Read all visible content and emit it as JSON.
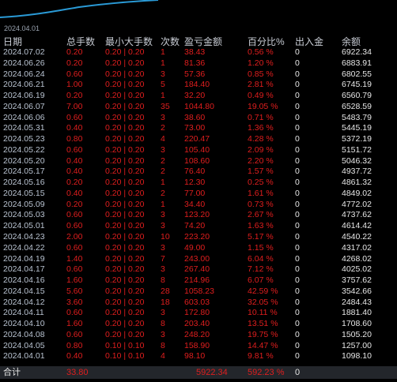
{
  "chart": {
    "date_label": "2024.04.01",
    "line_color": "#2a9ad6"
  },
  "table": {
    "headers": {
      "date": "日期",
      "lots": "总手数",
      "minmax": "最小大手数",
      "count": "次数",
      "pnl": "盈亏金额",
      "pct": "百分比%",
      "deposit": "出入金",
      "balance": "余额"
    },
    "rows": [
      {
        "date": "2024.07.02",
        "lots": "0.20",
        "minmax": "0.20 | 0.20",
        "count": "1",
        "pnl": "38.43",
        "pct": "0.56 %",
        "deposit": "0",
        "balance": "6922.34"
      },
      {
        "date": "2024.06.26",
        "lots": "0.20",
        "minmax": "0.20 | 0.20",
        "count": "1",
        "pnl": "81.36",
        "pct": "1.20 %",
        "deposit": "0",
        "balance": "6883.91"
      },
      {
        "date": "2024.06.24",
        "lots": "0.60",
        "minmax": "0.20 | 0.20",
        "count": "3",
        "pnl": "57.36",
        "pct": "0.85 %",
        "deposit": "0",
        "balance": "6802.55"
      },
      {
        "date": "2024.06.21",
        "lots": "1.00",
        "minmax": "0.20 | 0.20",
        "count": "5",
        "pnl": "184.40",
        "pct": "2.81 %",
        "deposit": "0",
        "balance": "6745.19"
      },
      {
        "date": "2024.06.19",
        "lots": "0.20",
        "minmax": "0.20 | 0.20",
        "count": "1",
        "pnl": "32.20",
        "pct": "0.49 %",
        "deposit": "0",
        "balance": "6560.79"
      },
      {
        "date": "2024.06.07",
        "lots": "7.00",
        "minmax": "0.20 | 0.20",
        "count": "35",
        "pnl": "1044.80",
        "pct": "19.05 %",
        "deposit": "0",
        "balance": "6528.59"
      },
      {
        "date": "2024.06.06",
        "lots": "0.60",
        "minmax": "0.20 | 0.20",
        "count": "3",
        "pnl": "38.60",
        "pct": "0.71 %",
        "deposit": "0",
        "balance": "5483.79"
      },
      {
        "date": "2024.05.31",
        "lots": "0.40",
        "minmax": "0.20 | 0.20",
        "count": "2",
        "pnl": "73.00",
        "pct": "1.36 %",
        "deposit": "0",
        "balance": "5445.19"
      },
      {
        "date": "2024.05.23",
        "lots": "0.80",
        "minmax": "0.20 | 0.20",
        "count": "4",
        "pnl": "220.47",
        "pct": "4.28 %",
        "deposit": "0",
        "balance": "5372.19"
      },
      {
        "date": "2024.05.22",
        "lots": "0.60",
        "minmax": "0.20 | 0.20",
        "count": "3",
        "pnl": "105.40",
        "pct": "2.09 %",
        "deposit": "0",
        "balance": "5151.72"
      },
      {
        "date": "2024.05.20",
        "lots": "0.40",
        "minmax": "0.20 | 0.20",
        "count": "2",
        "pnl": "108.60",
        "pct": "2.20 %",
        "deposit": "0",
        "balance": "5046.32"
      },
      {
        "date": "2024.05.17",
        "lots": "0.40",
        "minmax": "0.20 | 0.20",
        "count": "2",
        "pnl": "76.40",
        "pct": "1.57 %",
        "deposit": "0",
        "balance": "4937.72"
      },
      {
        "date": "2024.05.16",
        "lots": "0.20",
        "minmax": "0.20 | 0.20",
        "count": "1",
        "pnl": "12.30",
        "pct": "0.25 %",
        "deposit": "0",
        "balance": "4861.32"
      },
      {
        "date": "2024.05.15",
        "lots": "0.40",
        "minmax": "0.20 | 0.20",
        "count": "2",
        "pnl": "77.00",
        "pct": "1.61 %",
        "deposit": "0",
        "balance": "4849.02"
      },
      {
        "date": "2024.05.09",
        "lots": "0.20",
        "minmax": "0.20 | 0.20",
        "count": "1",
        "pnl": "34.40",
        "pct": "0.73 %",
        "deposit": "0",
        "balance": "4772.02"
      },
      {
        "date": "2024.05.03",
        "lots": "0.60",
        "minmax": "0.20 | 0.20",
        "count": "3",
        "pnl": "123.20",
        "pct": "2.67 %",
        "deposit": "0",
        "balance": "4737.62"
      },
      {
        "date": "2024.05.01",
        "lots": "0.60",
        "minmax": "0.20 | 0.20",
        "count": "3",
        "pnl": "74.20",
        "pct": "1.63 %",
        "deposit": "0",
        "balance": "4614.42"
      },
      {
        "date": "2024.04.23",
        "lots": "2.00",
        "minmax": "0.20 | 0.20",
        "count": "10",
        "pnl": "223.20",
        "pct": "5.17 %",
        "deposit": "0",
        "balance": "4540.22"
      },
      {
        "date": "2024.04.22",
        "lots": "0.60",
        "minmax": "0.20 | 0.20",
        "count": "3",
        "pnl": "49.00",
        "pct": "1.15 %",
        "deposit": "0",
        "balance": "4317.02"
      },
      {
        "date": "2024.04.19",
        "lots": "1.40",
        "minmax": "0.20 | 0.20",
        "count": "7",
        "pnl": "243.00",
        "pct": "6.04 %",
        "deposit": "0",
        "balance": "4268.02"
      },
      {
        "date": "2024.04.17",
        "lots": "0.60",
        "minmax": "0.20 | 0.20",
        "count": "3",
        "pnl": "267.40",
        "pct": "7.12 %",
        "deposit": "0",
        "balance": "4025.02"
      },
      {
        "date": "2024.04.16",
        "lots": "1.60",
        "minmax": "0.20 | 0.20",
        "count": "8",
        "pnl": "214.96",
        "pct": "6.07 %",
        "deposit": "0",
        "balance": "3757.62"
      },
      {
        "date": "2024.04.15",
        "lots": "5.60",
        "minmax": "0.20 | 0.20",
        "count": "28",
        "pnl": "1058.23",
        "pct": "42.59 %",
        "deposit": "0",
        "balance": "3542.66"
      },
      {
        "date": "2024.04.12",
        "lots": "3.60",
        "minmax": "0.20 | 0.20",
        "count": "18",
        "pnl": "603.03",
        "pct": "32.05 %",
        "deposit": "0",
        "balance": "2484.43"
      },
      {
        "date": "2024.04.11",
        "lots": "0.60",
        "minmax": "0.20 | 0.20",
        "count": "3",
        "pnl": "172.80",
        "pct": "10.11 %",
        "deposit": "0",
        "balance": "1881.40"
      },
      {
        "date": "2024.04.10",
        "lots": "1.60",
        "minmax": "0.20 | 0.20",
        "count": "8",
        "pnl": "203.40",
        "pct": "13.51 %",
        "deposit": "0",
        "balance": "1708.60"
      },
      {
        "date": "2024.04.08",
        "lots": "0.60",
        "minmax": "0.20 | 0.20",
        "count": "3",
        "pnl": "248.20",
        "pct": "19.75 %",
        "deposit": "0",
        "balance": "1505.20"
      },
      {
        "date": "2024.04.05",
        "lots": "0.80",
        "minmax": "0.10 | 0.10",
        "count": "8",
        "pnl": "158.90",
        "pct": "14.47 %",
        "deposit": "0",
        "balance": "1257.00"
      },
      {
        "date": "2024.04.01",
        "lots": "0.40",
        "minmax": "0.10 | 0.10",
        "count": "4",
        "pnl": "98.10",
        "pct": "9.81 %",
        "deposit": "0",
        "balance": "1098.10"
      }
    ],
    "total": {
      "label": "合计",
      "lots": "33.80",
      "pnl": "5922.34",
      "pct": "592.23 %",
      "deposit": "0"
    }
  }
}
